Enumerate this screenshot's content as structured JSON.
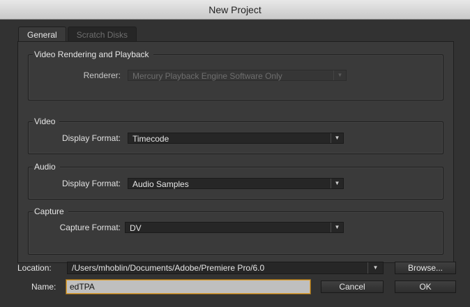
{
  "window": {
    "title": "New Project"
  },
  "tabs": [
    {
      "label": "General",
      "active": true
    },
    {
      "label": "Scratch Disks",
      "active": false
    }
  ],
  "video_rendering": {
    "legend": "Video Rendering and Playback",
    "renderer_label": "Renderer:",
    "renderer_value": "Mercury Playback Engine Software Only",
    "renderer_disabled": true
  },
  "video": {
    "legend": "Video",
    "display_format_label": "Display Format:",
    "display_format_value": "Timecode"
  },
  "audio": {
    "legend": "Audio",
    "display_format_label": "Display Format:",
    "display_format_value": "Audio Samples"
  },
  "capture": {
    "legend": "Capture",
    "capture_format_label": "Capture Format:",
    "capture_format_value": "DV"
  },
  "location": {
    "label": "Location:",
    "path": "/Users/mhoblin/Documents/Adobe/Premiere Pro/6.0",
    "browse_label": "Browse..."
  },
  "name": {
    "label": "Name:",
    "value": "edTPA"
  },
  "buttons": {
    "cancel": "Cancel",
    "ok": "OK"
  },
  "icons": {
    "dropdown": "chevron-down-icon"
  }
}
